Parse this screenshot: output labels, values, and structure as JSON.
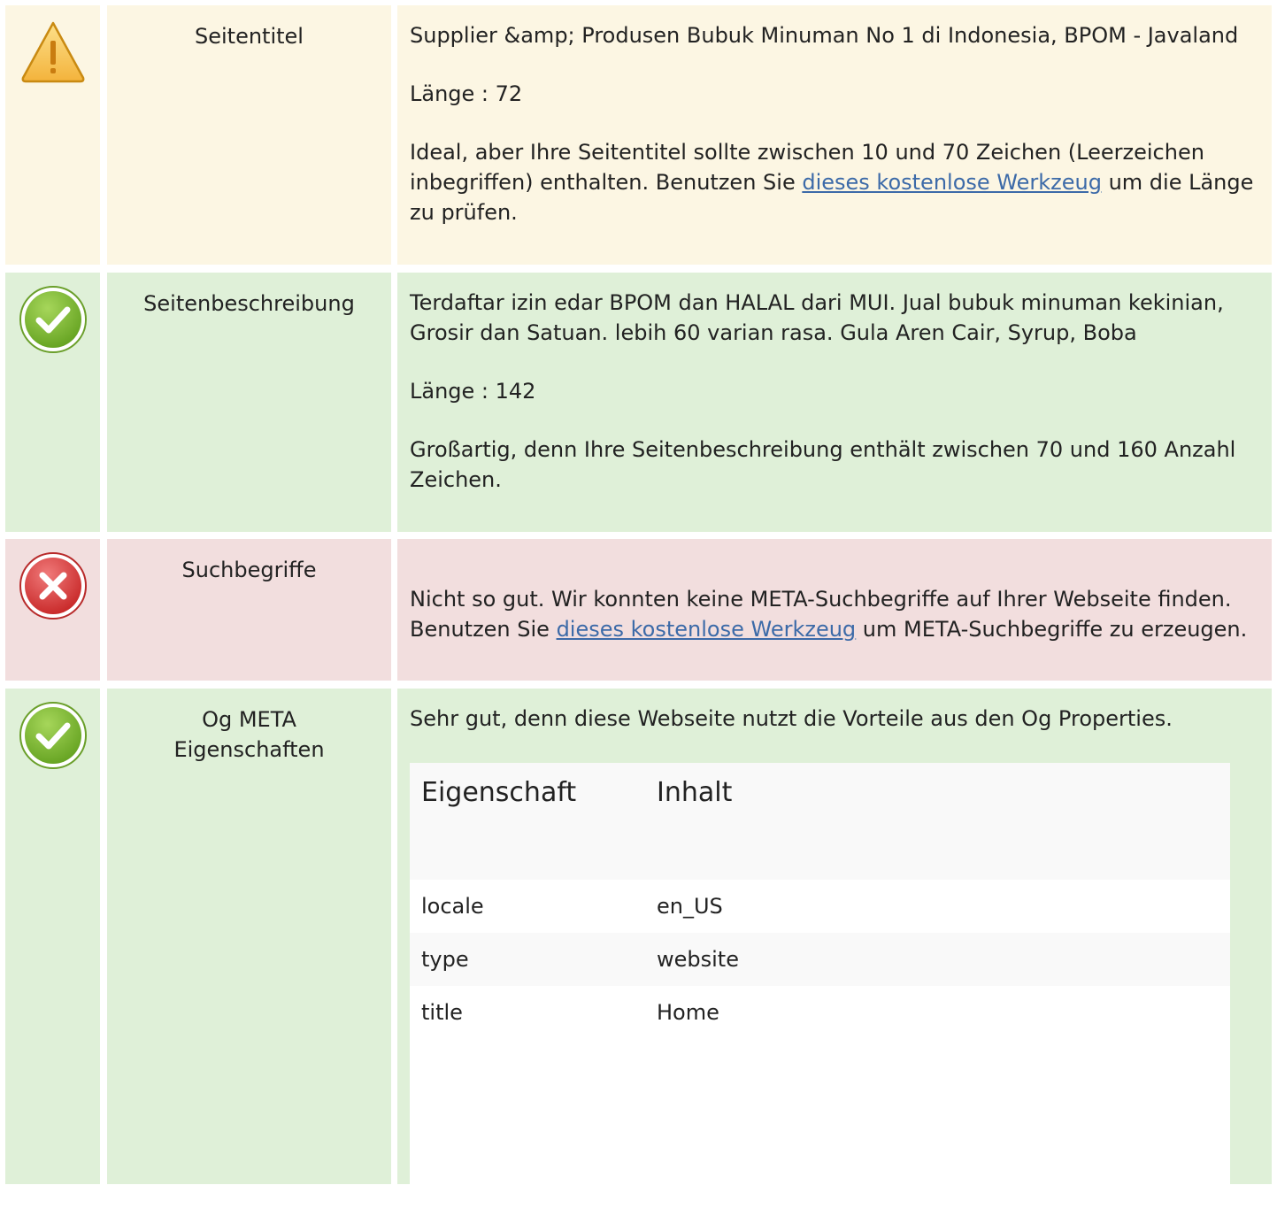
{
  "rows": [
    {
      "status": "warning",
      "icon": "warning-icon",
      "label": "Seitentitel",
      "value": "Supplier &amp; Produsen Bubuk Minuman No 1 di Indonesia, BPOM - Javaland",
      "length": "Länge : 72",
      "message_pre": "Ideal, aber Ihre Seitentitel sollte zwischen 10 und 70 Zeichen (Leerzeichen inbegriffen) enthalten. Benutzen Sie ",
      "message_link": "dieses kostenlose Werkzeug",
      "message_post": " um die Länge zu prüfen."
    },
    {
      "status": "ok",
      "icon": "check-icon",
      "label": "Seitenbeschreibung",
      "value": "Terdaftar izin edar BPOM dan HALAL dari MUI. Jual bubuk minuman kekinian, Grosir dan Satuan. lebih 60 varian rasa. Gula Aren Cair, Syrup, Boba",
      "length": "Länge : 142",
      "message": "Großartig, denn Ihre Seitenbeschreibung enthält zwischen 70 und 160 Anzahl Zeichen."
    },
    {
      "status": "error",
      "icon": "error-icon",
      "label": "Suchbegriffe",
      "message_pre": "Nicht so gut. Wir konnten keine META-Suchbegriffe auf Ihrer Webseite finden. Benutzen Sie ",
      "message_link": "dieses kostenlose Werkzeug",
      "message_post": " um META-Suchbegriffe zu erzeugen."
    },
    {
      "status": "ok",
      "icon": "check-icon",
      "label": "Og META Eigenschaften",
      "message": "Sehr gut, denn diese Webseite nutzt die Vorteile aus den Og Properties.",
      "table": {
        "headers": [
          "Eigenschaft",
          "Inhalt"
        ],
        "rows": [
          {
            "property": "locale",
            "content": "en_US"
          },
          {
            "property": "type",
            "content": "website"
          },
          {
            "property": "title",
            "content": "Home"
          }
        ]
      }
    }
  ],
  "colors": {
    "warning_bg": "#fcf6e3",
    "ok_bg": "#dff0d8",
    "error_bg": "#f2dede",
    "link": "#3c6aa8"
  }
}
